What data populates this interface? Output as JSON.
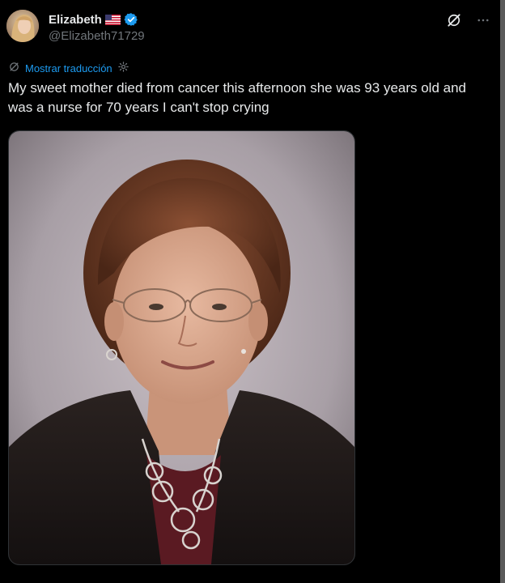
{
  "author": {
    "display_name": "Elizabeth",
    "handle": "@Elizabeth71729",
    "flag_icon": "us-flag-icon",
    "verified_icon": "verified-badge-icon",
    "verified_color": "#1d9bf0"
  },
  "actions": {
    "grok_icon": "grok-icon",
    "more_icon": "more-dots-icon"
  },
  "translation": {
    "label": "Mostrar traducción",
    "link_color": "#1d9bf0",
    "icon": "translate-icon",
    "settings_icon": "gear-icon"
  },
  "tweet": {
    "text": "My sweet mother died from cancer this afternoon she was 93 years old and was a nurse for 70 years I can't stop crying"
  },
  "media": {
    "kind": "photo",
    "subject": "portrait"
  },
  "colors": {
    "background": "#000000",
    "text_primary": "#e7e9ea",
    "text_secondary": "#71767b"
  }
}
